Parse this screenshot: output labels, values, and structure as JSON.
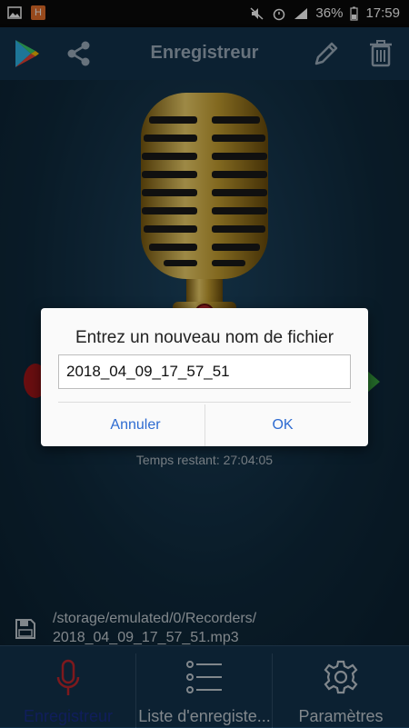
{
  "status_bar": {
    "battery": "36%",
    "time": "17:59",
    "notif_badge": "H"
  },
  "toolbar": {
    "title": "Enregistreur",
    "icons": [
      "play-store-icon",
      "share-icon",
      "edit-icon",
      "delete-icon"
    ]
  },
  "main": {
    "remaining_time": "Temps restant: 27:04:05",
    "path_line1": "/storage/emulated/0/Recorders/",
    "path_line2": "2018_04_09_17_57_51.mp3"
  },
  "bottom_nav": {
    "tabs": [
      {
        "label": "Enregistreur",
        "icon": "microphone-icon",
        "active": true
      },
      {
        "label": "Liste d'enregiste...",
        "icon": "list-icon",
        "active": false
      },
      {
        "label": "Paramètres",
        "icon": "gear-icon",
        "active": false
      }
    ]
  },
  "dialog": {
    "title": "Entrez un nouveau nom de fichier",
    "value": "2018_04_09_17_57_51",
    "cancel_label": "Annuler",
    "ok_label": "OK"
  },
  "colors": {
    "background": "#0f2a3d",
    "toolbar": "#13334e",
    "accent_blue": "#2d6bd1",
    "active_tab": "#1a2f8c"
  }
}
